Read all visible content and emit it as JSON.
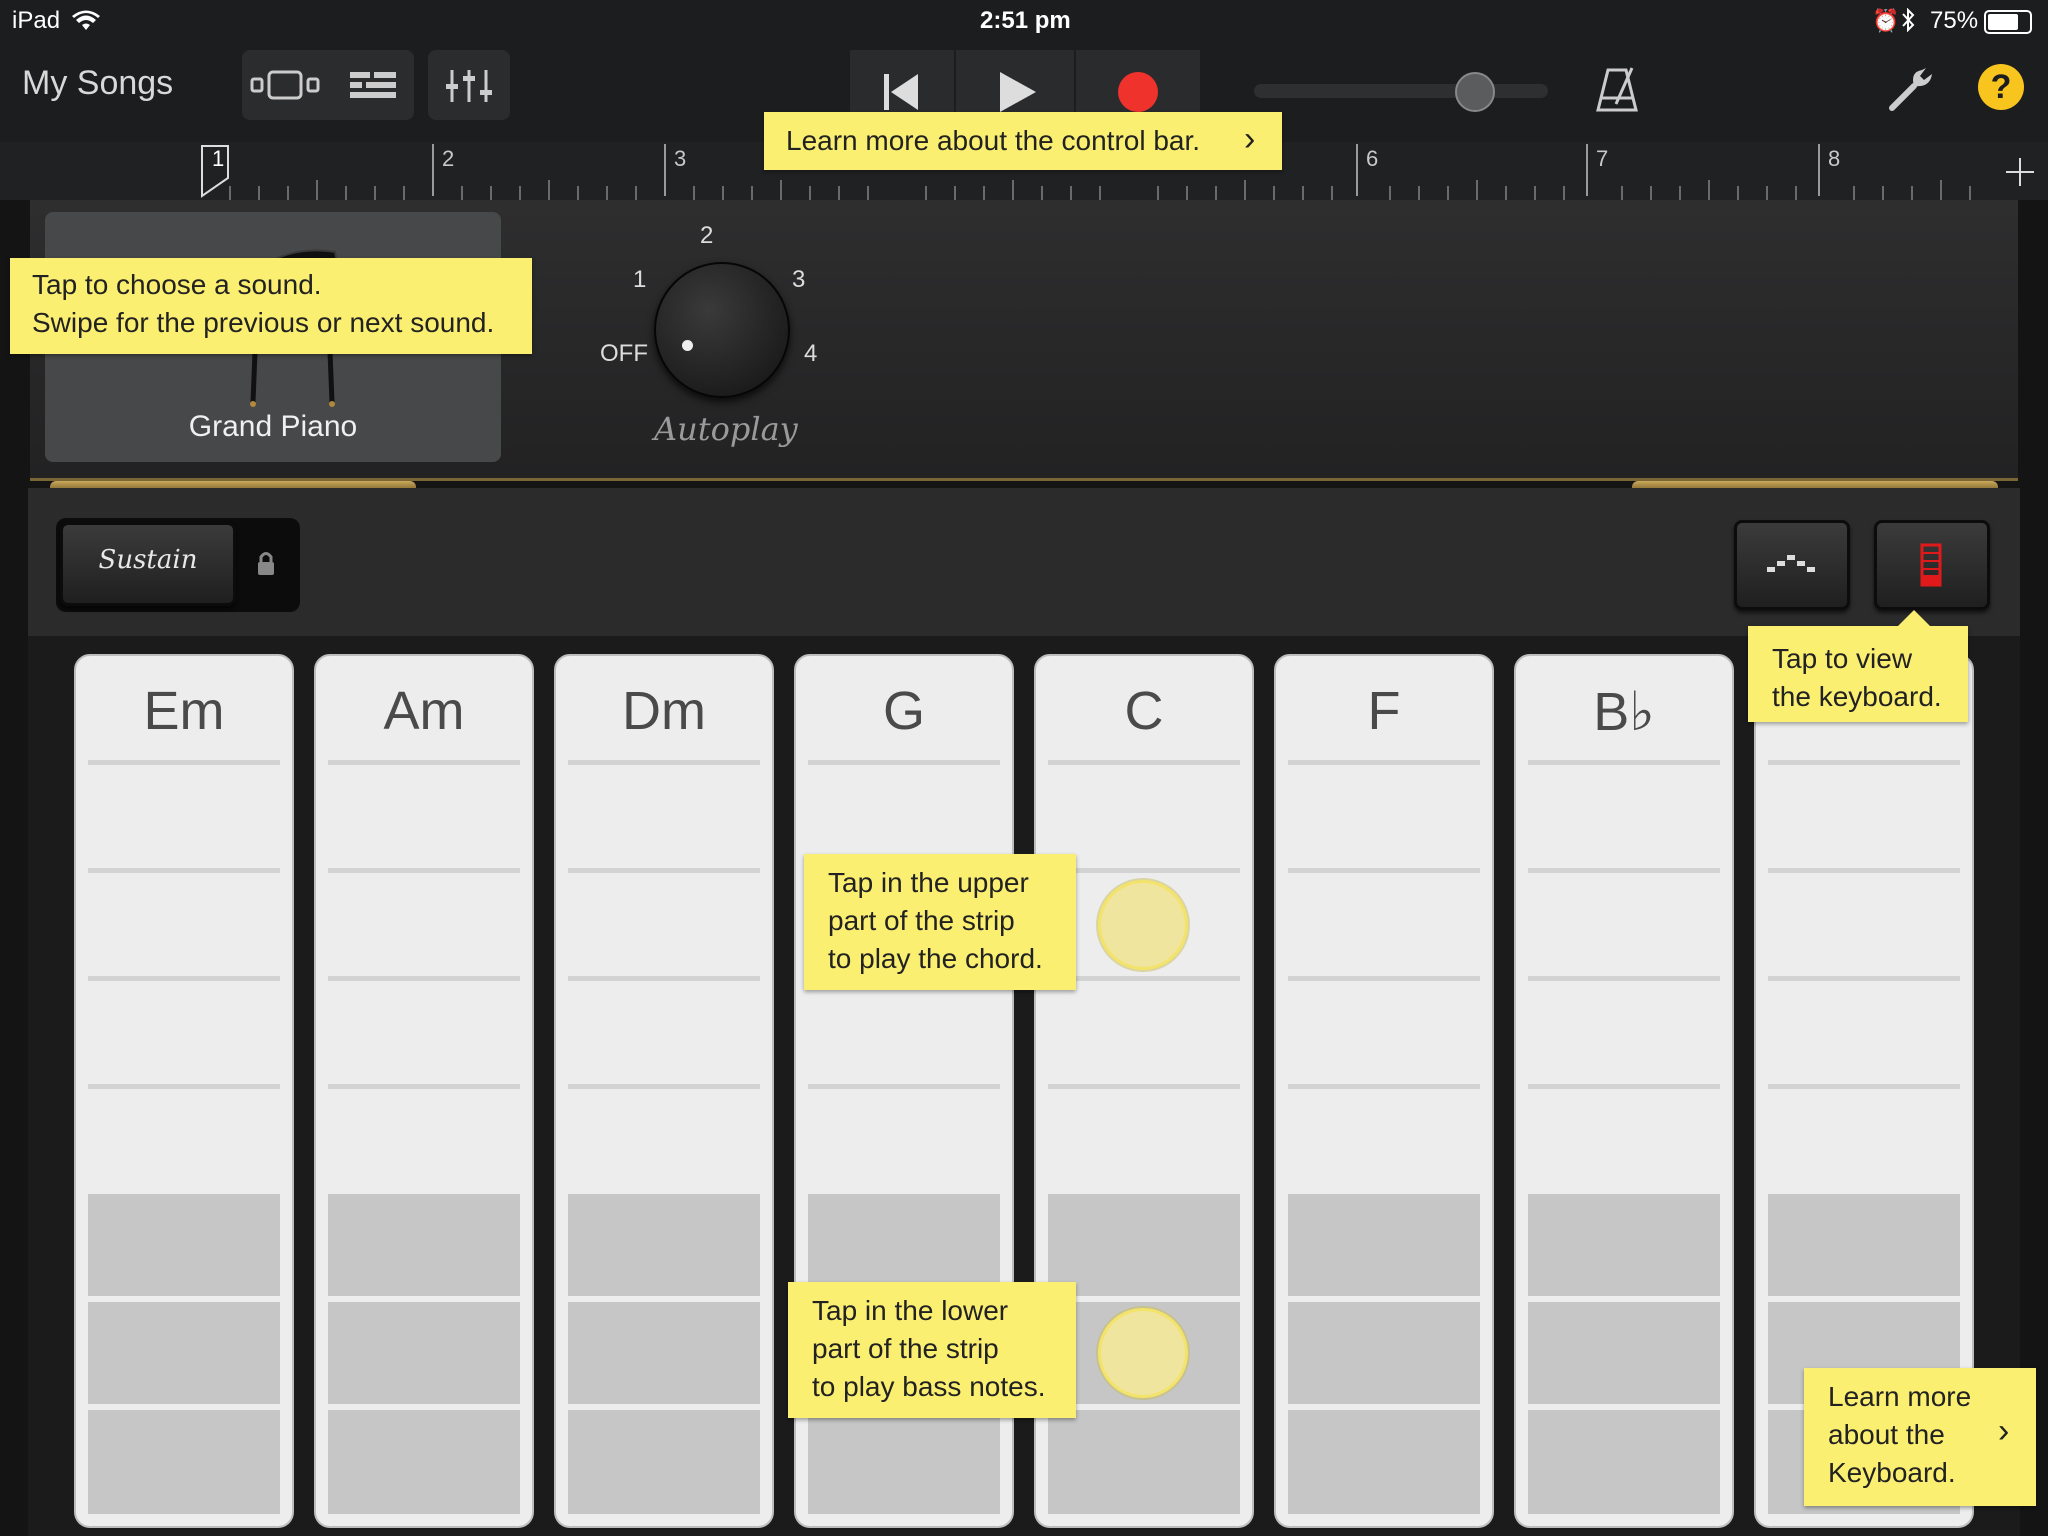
{
  "status": {
    "device": "iPad",
    "time": "2:51 pm",
    "battery": "75%"
  },
  "controlbar": {
    "my_songs": "My Songs",
    "help": "?",
    "tempo_slider": 0.78
  },
  "ruler": {
    "bars": [
      "1",
      "2",
      "3",
      "6",
      "7",
      "8"
    ]
  },
  "instrument": {
    "sound_name": "Grand Piano",
    "autoplay_label": "Autoplay",
    "autoplay_positions": [
      "OFF",
      "1",
      "2",
      "3",
      "4"
    ],
    "autoplay_value": "OFF"
  },
  "controls": {
    "sustain_label": "Sustain"
  },
  "chords": [
    "Em",
    "Am",
    "Dm",
    "G",
    "C",
    "F",
    "B♭",
    ""
  ],
  "tips": {
    "control_bar": "Learn more about the control bar.",
    "sound_line1": "Tap to choose a sound.",
    "sound_line2": "Swipe for the previous or next sound.",
    "view_kb_line1": "Tap to view",
    "view_kb_line2": "the keyboard.",
    "upper_line1": "Tap in the upper",
    "upper_line2": "part of the strip",
    "upper_line3": "to play the chord.",
    "lower_line1": "Tap in the lower",
    "lower_line2": "part of the strip",
    "lower_line3": "to play bass notes.",
    "keyboard_line1": "Learn more",
    "keyboard_line2": "about the",
    "keyboard_line3": "Keyboard."
  },
  "colors": {
    "tip_yellow": "#fbef72",
    "record_red": "#f0322d",
    "help_yellow": "#f7c51e",
    "accent_gold": "#7a6635"
  }
}
